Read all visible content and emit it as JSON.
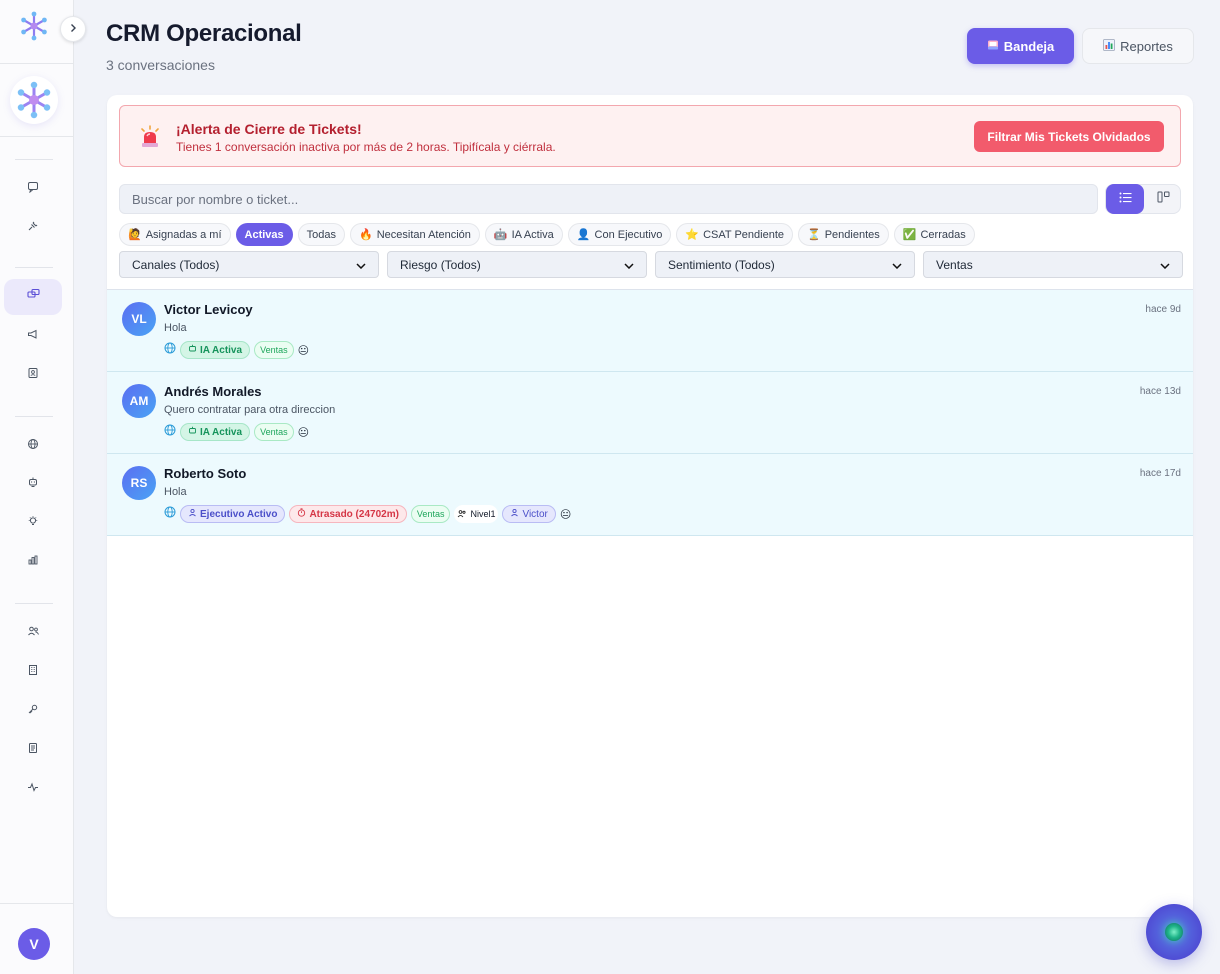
{
  "header": {
    "title": "CRM Operacional",
    "subtitle": "3 conversaciones",
    "bandeja_label": "Bandeja",
    "reportes_label": "Reportes"
  },
  "alert": {
    "title": "¡Alerta de Cierre de Tickets!",
    "text": "Tienes 1 conversación inactiva por más de 2 horas. Tipifícala y ciérrala.",
    "button": "Filtrar Mis Tickets Olvidados"
  },
  "search": {
    "placeholder": "Buscar por nombre o ticket..."
  },
  "chips": [
    {
      "label": "Asignadas a mí",
      "emoji": "🙋"
    },
    {
      "label": "Activas",
      "emoji": ""
    },
    {
      "label": "Todas",
      "emoji": ""
    },
    {
      "label": "Necesitan Atención",
      "emoji": "🔥"
    },
    {
      "label": "IA Activa",
      "emoji": "🤖"
    },
    {
      "label": "Con Ejecutivo",
      "emoji": "👤"
    },
    {
      "label": "CSAT Pendiente",
      "emoji": "⭐"
    },
    {
      "label": "Pendientes",
      "emoji": "⏳"
    },
    {
      "label": "Cerradas",
      "emoji": "✅"
    }
  ],
  "filters": {
    "canales": "Canales (Todos)",
    "riesgo": "Riesgo (Todos)",
    "sentimiento": "Sentimiento (Todos)",
    "area": "Ventas"
  },
  "conversations": [
    {
      "initials": "VL",
      "name": "Victor Levicoy",
      "message": "Hola",
      "time": "hace 9d",
      "status": "IA Activa",
      "area": "Ventas"
    },
    {
      "initials": "AM",
      "name": "Andrés Morales",
      "message": "Quero contratar para otra direccion",
      "time": "hace 13d",
      "status": "IA Activa",
      "area": "Ventas"
    },
    {
      "initials": "RS",
      "name": "Roberto Soto",
      "message": "Hola",
      "time": "hace 17d",
      "status": "Ejecutivo Activo",
      "late": "Atrasado (24702m)",
      "area": "Ventas",
      "level": "Nivel1",
      "agent": "Victor"
    }
  ],
  "user": {
    "initial": "V"
  },
  "colors": {
    "accent": "#6b5ce7",
    "alert": "#f25b6c",
    "row": "#edfafe"
  }
}
